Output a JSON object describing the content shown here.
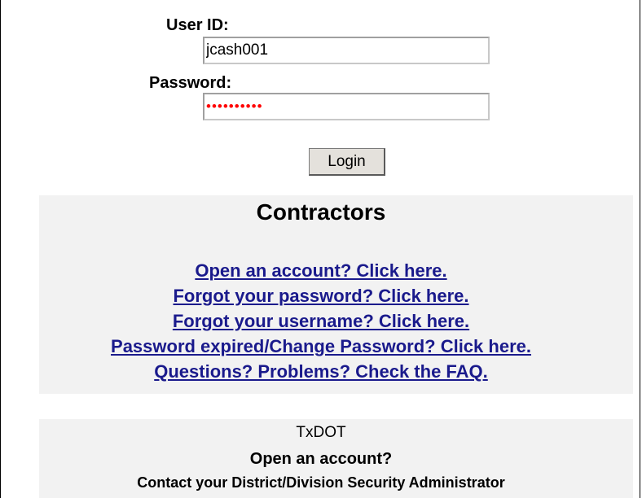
{
  "login": {
    "userid_label": "User ID:",
    "userid_value": "jcash001",
    "password_label": "Password:",
    "password_value": "••••••••••",
    "login_button": "Login"
  },
  "contractors": {
    "title": "Contractors",
    "links": [
      "Open an account? Click here.",
      "Forgot your password? Click here.",
      "Forgot your username? Click here.",
      "Password expired/Change Password? Click here.",
      "Questions? Problems? Check the FAQ."
    ]
  },
  "txdot": {
    "title": "TxDOT",
    "open_account": "Open an account?",
    "contact": "Contact your District/Division Security Administrator"
  },
  "colors": {
    "link": "#1a1a8c",
    "password_mask": "#ff0000",
    "panel_background": "#f2f2f2",
    "button_face": "#e4e1dc"
  }
}
